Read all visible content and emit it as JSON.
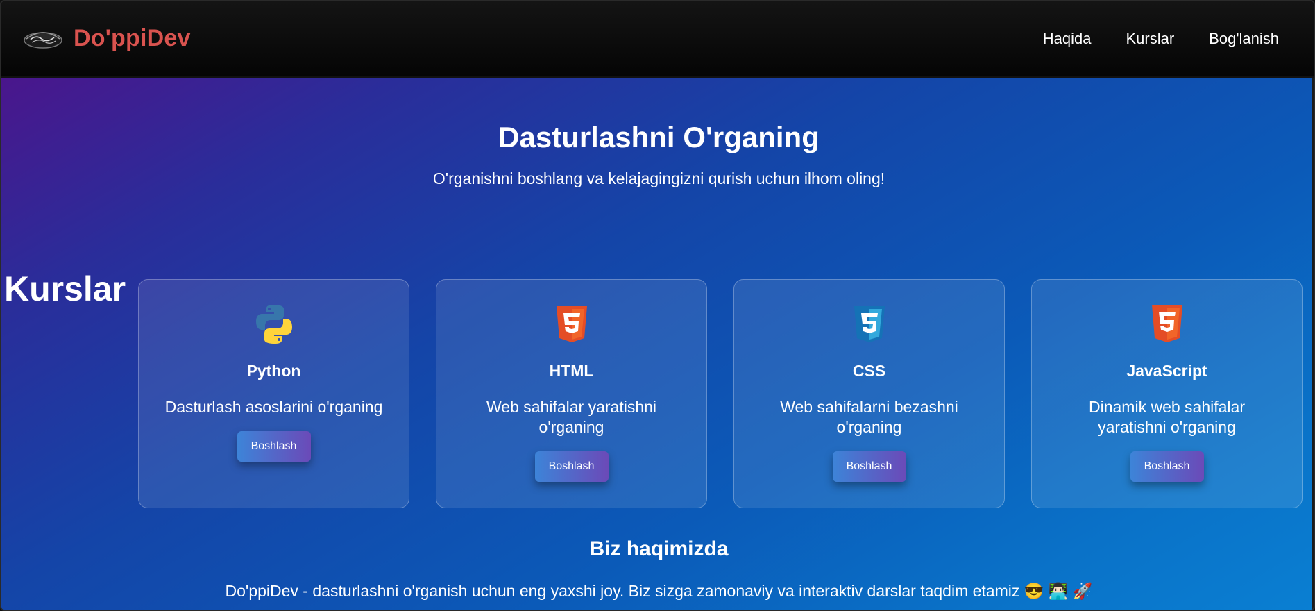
{
  "brand": {
    "name": "Do'ppiDev",
    "logo_icon": "doppi-cap-icon"
  },
  "nav": {
    "links": [
      "Haqida",
      "Kurslar",
      "Bog'lanish"
    ]
  },
  "hero": {
    "title": "Dasturlashni O'rganing",
    "subtitle": "O'rganishni boshlang va kelajagingizni qurish uchun ilhom oling!"
  },
  "courses": {
    "section_title": "Kurslar",
    "items": [
      {
        "title": "Python",
        "description": "Dasturlash asoslarini o'rganing",
        "button": "Boshlash",
        "icon": "python-icon"
      },
      {
        "title": "HTML",
        "description": "Web sahifalar yaratishni o'rganing",
        "button": "Boshlash",
        "icon": "html5-icon"
      },
      {
        "title": "CSS",
        "description": "Web sahifalarni bezashni o'rganing",
        "button": "Boshlash",
        "icon": "css3-icon"
      },
      {
        "title": "JavaScript",
        "description": "Dinamik web sahifalar yaratishni o'rganing",
        "button": "Boshlash",
        "icon": "html5-icon"
      }
    ]
  },
  "about": {
    "title": "Biz haqimizda",
    "text": "Do'ppiDev - dasturlashni o'rganish uchun eng yaxshi joy. Biz sizga zamonaviy va interaktiv darslar taqdim etamiz 😎 👨🏻‍💻 🚀"
  },
  "colors": {
    "brand": "#d9534f",
    "navbar": "#0a0a0a",
    "gradient_start": "#4a168c",
    "gradient_end": "#0a7fd2",
    "button_start": "#3d84d8",
    "button_end": "#6b4ab8"
  }
}
